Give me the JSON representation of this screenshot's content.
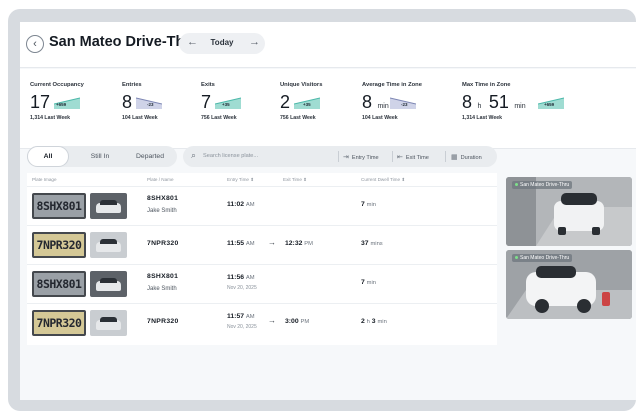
{
  "header": {
    "title": "San Mateo Drive-Thru",
    "date_label": "Today",
    "prev_icon": "arrow-left-icon",
    "next_icon": "arrow-right-icon",
    "back_icon": "chevron-left-icon"
  },
  "stats": [
    {
      "label": "Current Occupancy",
      "value": "17",
      "unit": "",
      "delta": "+659",
      "sub": "1,314 Last Week",
      "trend": "up"
    },
    {
      "label": "Entries",
      "value": "8",
      "unit": "",
      "delta": "-23",
      "sub": "104 Last Week",
      "trend": "down"
    },
    {
      "label": "Exits",
      "value": "7",
      "unit": "",
      "delta": "+35",
      "sub": "756 Last Week",
      "trend": "up"
    },
    {
      "label": "Unique Visitors",
      "value": "2",
      "unit": "",
      "delta": "+35",
      "sub": "756 Last Week",
      "trend": "up"
    },
    {
      "label": "Average Time in Zone",
      "value": "8",
      "unit": "min",
      "delta": "-23",
      "sub": "104 Last Week",
      "trend": "down"
    },
    {
      "label": "Max Time in Zone",
      "value": "8",
      "unit": "h",
      "value2": "51",
      "unit2": "min",
      "delta": "+659",
      "sub": "1,314 Last Week",
      "trend": "up"
    }
  ],
  "filters": {
    "tabs": [
      "All",
      "Still In",
      "Departed"
    ],
    "active": "All"
  },
  "search": {
    "placeholder": "Search license plate...",
    "entry_time": "Entry Time",
    "exit_time": "Exit Time",
    "duration": "Duration"
  },
  "table": {
    "headers": [
      "Plate Image",
      "Plate / Name",
      "Entry Time",
      "Exit Time",
      "Current Dwell Time"
    ],
    "rows": [
      {
        "plate_img": "8SHX801",
        "plate": "8SHX801",
        "name": "Jake Smith",
        "entry": "11:02",
        "entry_ampm": "AM",
        "entry_date": "",
        "exit": "",
        "exit_ampm": "",
        "dwell_a": "7",
        "dwell_a_unit": "min",
        "dwell_b": "",
        "dwell_b_unit": ""
      },
      {
        "plate_img": "7NPR320",
        "plate": "7NPR320",
        "name": "",
        "entry": "11:55",
        "entry_ampm": "AM",
        "entry_date": "",
        "exit": "12:32",
        "exit_ampm": "PM",
        "dwell_a": "37",
        "dwell_a_unit": "mins",
        "dwell_b": "",
        "dwell_b_unit": ""
      },
      {
        "plate_img": "8SHX801",
        "plate": "8SHX801",
        "name": "Jake Smith",
        "entry": "11:56",
        "entry_ampm": "AM",
        "entry_date": "Nov 20, 2025",
        "exit": "",
        "exit_ampm": "",
        "dwell_a": "7",
        "dwell_a_unit": "min",
        "dwell_b": "",
        "dwell_b_unit": ""
      },
      {
        "plate_img": "7NPR320",
        "plate": "7NPR320",
        "name": "",
        "entry": "11:57",
        "entry_ampm": "AM",
        "entry_date": "Nov 20, 2025",
        "exit": "3:00",
        "exit_ampm": "PM",
        "dwell_a": "2",
        "dwell_a_unit": "h",
        "dwell_b": "3",
        "dwell_b_unit": "min"
      }
    ]
  },
  "cameras": [
    {
      "label": "San Mateo Drive-Thru"
    },
    {
      "label": "San Mateo Drive-Thru"
    }
  ],
  "colors": {
    "accent_trend": "#4bb8a9",
    "background": "#f6f8fa",
    "frame": "#d7dbe0"
  }
}
